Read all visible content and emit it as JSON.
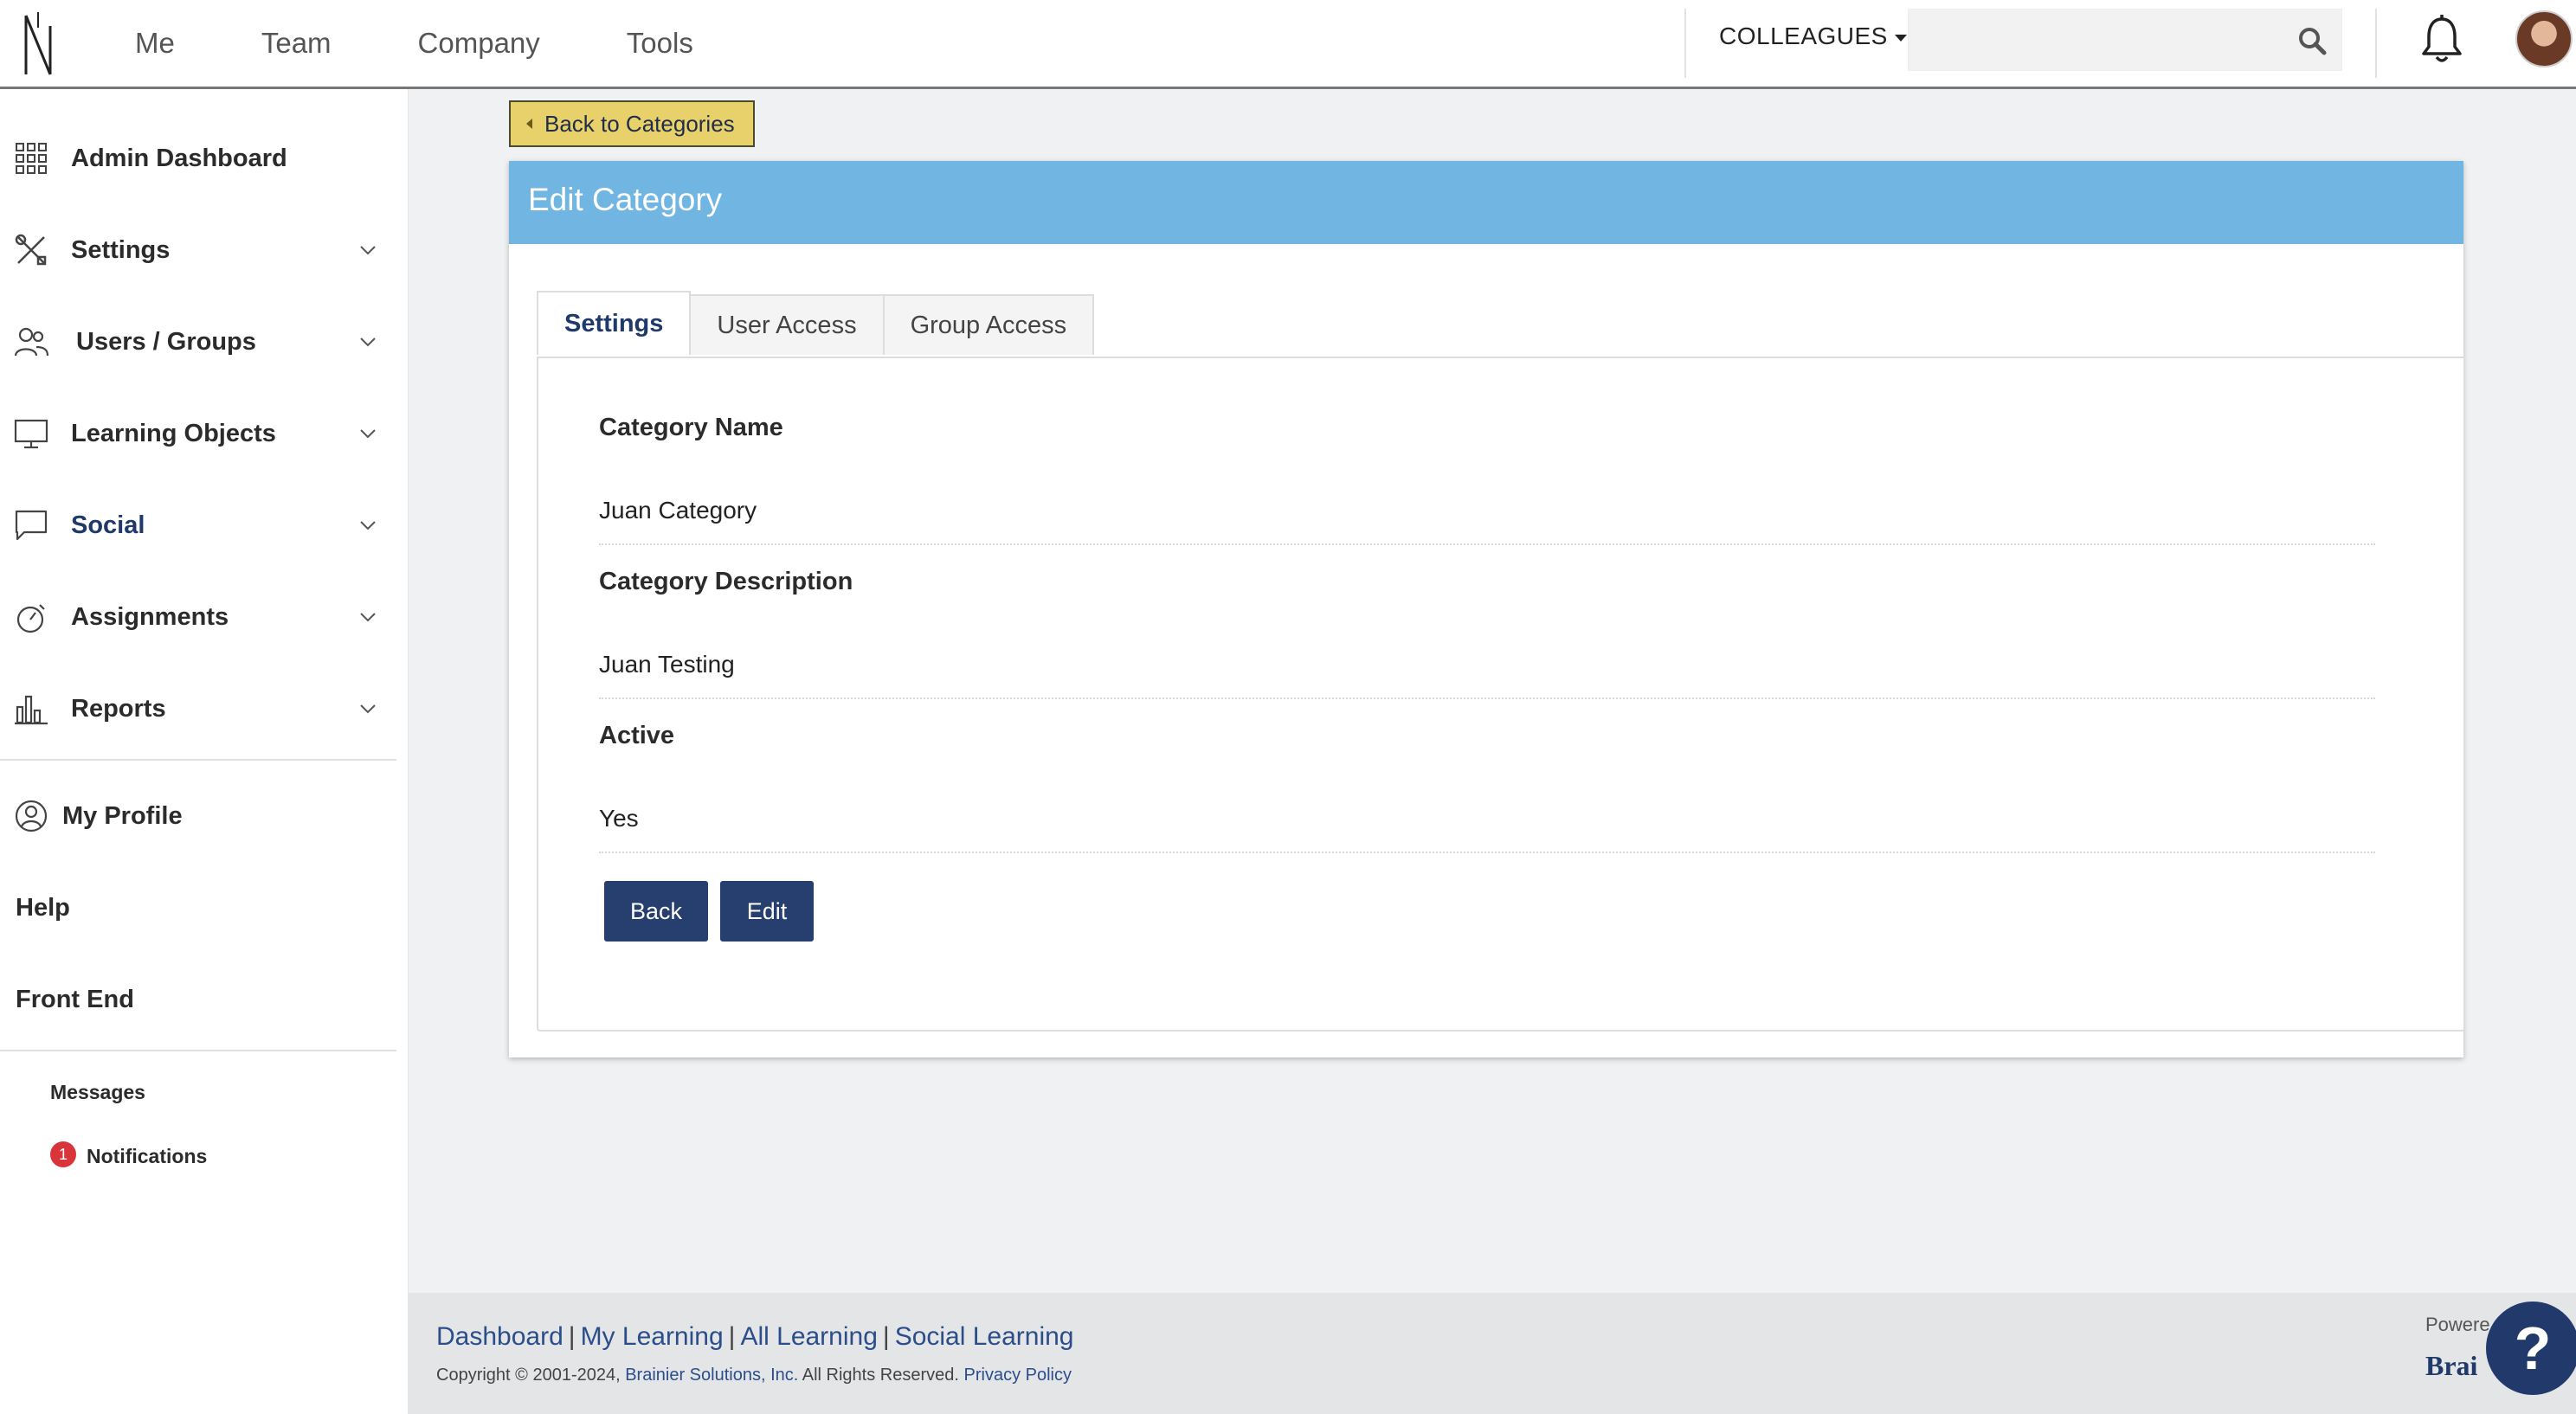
{
  "topnav": {
    "items": [
      "Me",
      "Team",
      "Company",
      "Tools"
    ],
    "colleagues_label": "COLLEAGUES",
    "search_placeholder": ""
  },
  "sidebar": {
    "items": [
      {
        "label": "Admin Dashboard",
        "icon": "grid-icon"
      },
      {
        "label": "Settings",
        "icon": "tools-icon"
      },
      {
        "label": "Users / Groups",
        "icon": "users-icon"
      },
      {
        "label": "Learning Objects",
        "icon": "monitor-icon"
      },
      {
        "label": "Social",
        "icon": "chat-icon"
      },
      {
        "label": "Assignments",
        "icon": "stopwatch-icon"
      },
      {
        "label": "Reports",
        "icon": "bar-chart-icon"
      }
    ],
    "my_profile": "My Profile",
    "help": "Help",
    "front_end": "Front End",
    "messages": "Messages",
    "notifications": "Notifications",
    "notifications_count": "1"
  },
  "main": {
    "back_to_categories": "Back to Categories",
    "panel_title": "Edit Category",
    "tabs": [
      "Settings",
      "User Access",
      "Group Access"
    ],
    "active_tab": "Settings",
    "fields": [
      {
        "label": "Category Name",
        "value": "Juan Category"
      },
      {
        "label": "Category Description",
        "value": "Juan Testing"
      },
      {
        "label": "Active",
        "value": "Yes"
      }
    ],
    "back_button": "Back",
    "edit_button": "Edit"
  },
  "footer": {
    "links": [
      "Dashboard",
      "My Learning",
      "All Learning",
      "Social Learning"
    ],
    "copyright_prefix": "Copyright © 2001-2024, ",
    "company": "Brainier Solutions, Inc.",
    "rights": " All Rights Reserved. ",
    "privacy": "Privacy Policy",
    "powered": "Powere",
    "brand": "Brai"
  },
  "colors": {
    "panel_header": "#71b5e2",
    "button": "#263f6f",
    "back_categories_bg": "#e8d06a",
    "badge": "#d9343a"
  }
}
